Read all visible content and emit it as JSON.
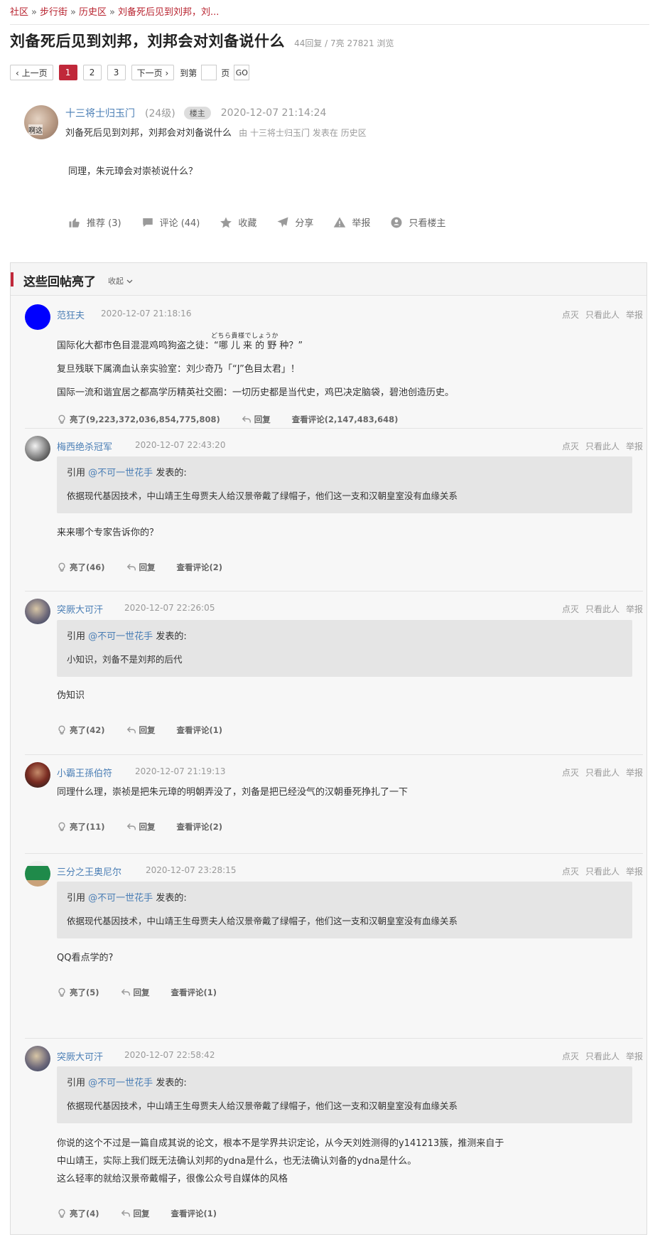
{
  "breadcrumb": [
    "社区",
    "步行街",
    "历史区",
    "刘备死后见到刘邦，刘..."
  ],
  "breadcrumb_sep": "»",
  "title": "刘备死后见到刘邦，刘邦会对刘备说什么",
  "stats": "44回复 / 7亮 27821 浏览",
  "pager": {
    "prev": "‹ 上一页",
    "pages": [
      "1",
      "2",
      "3"
    ],
    "next": "下一页 ›",
    "goto_before": "到第",
    "goto_after": "页",
    "go": "GO"
  },
  "op": {
    "avatar_text": "啊这",
    "author": "十三将士归玉门",
    "level": "(24级)",
    "badge": "楼主",
    "time": "2020-12-07 21:14:24",
    "subtitle": "刘备死后见到刘邦，刘邦会对刘备说什么",
    "by_prefix": "由",
    "by_author": "十三将士归玉门",
    "by_mid": "发表在",
    "by_section": "历史区",
    "body": "同理，朱元璋会对崇祯说什么？",
    "actions": {
      "recommend": "推荐 (3)",
      "comment": "评论 (44)",
      "favorite": "收藏",
      "share": "分享",
      "report": "举报",
      "only_op": "只看楼主"
    }
  },
  "hot": {
    "title": "这些回帖亮了",
    "collapse": "收起"
  },
  "reply_opts": {
    "dislike": "点灭",
    "only_this": "只看此人",
    "report": "举报"
  },
  "reply_actions": {
    "reply": "回复"
  },
  "quote_prefix": "引用",
  "quote_suffix": "发表的:",
  "replies": [
    {
      "author": "范狂夫",
      "time": "2020-12-07 21:18:16",
      "avatar_color": "#0000ff",
      "ruby": "どちら貴様でしょうか",
      "lines": [
        "国际化大都市色目混混鸡鸣狗盗之徒：“哪 儿 来 的 野 种？”",
        "复旦残联下属滴血认亲实验室：刘少奇乃「“J”色目太君」！",
        "国际一流和谐宜居之都高学历精英社交圈：一切历史都是当代史，鸡巴决定脑袋，碧池创造历史。"
      ],
      "light": "亮了(9,223,372,036,854,775,808)",
      "comments": "查看评论(2,147,483,648)"
    },
    {
      "author": "梅西绝杀冠军",
      "time": "2020-12-07 22:43:20",
      "quote_user": "@不可一世花手",
      "quote_text": "依据现代基因技术，中山靖王生母贾夫人给汉景帝戴了绿帽子，他们这一支和汉朝皇室没有血缘关系",
      "lines": [
        "来来哪个专家告诉你的？"
      ],
      "light": "亮了(46)",
      "comments": "查看评论(2)"
    },
    {
      "author": "突厥大可汗",
      "time": "2020-12-07 22:26:05",
      "quote_user": "@不可一世花手",
      "quote_text": "小知识，刘备不是刘邦的后代",
      "lines": [
        "伪知识"
      ],
      "light": "亮了(42)",
      "comments": "查看评论(1)"
    },
    {
      "author": "小霸王孫伯符",
      "time": "2020-12-07 21:19:13",
      "lines": [
        "同理什么理，崇祯是把朱元璋的明朝弄没了，刘备是把已经没气的汉朝垂死挣扎了一下"
      ],
      "light": "亮了(11)",
      "comments": "查看评论(2)"
    },
    {
      "author": "三分之王奥尼尔",
      "time": "2020-12-07 23:28:15",
      "quote_user": "@不可一世花手",
      "quote_text": "依据现代基因技术，中山靖王生母贾夫人给汉景帝戴了绿帽子，他们这一支和汉朝皇室没有血缘关系",
      "lines": [
        "QQ看点学的?"
      ],
      "light": "亮了(5)",
      "comments": "查看评论(1)"
    },
    {
      "author": "突厥大可汗",
      "time": "2020-12-07 22:58:42",
      "quote_user": "@不可一世花手",
      "quote_text": "依据现代基因技术，中山靖王生母贾夫人给汉景帝戴了绿帽子，他们这一支和汉朝皇室没有血缘关系",
      "lines": [
        "你说的这个不过是一篇自成其说的论文，根本不是学界共识定论，从今天刘姓测得的y141213簇，推测来自于",
        "中山靖王，实际上我们既无法确认刘邦的ydna是什么，也无法确认刘备的ydna是什么。",
        "这么轻率的就给汉景帝戴帽子，很像公众号自媒体的风格"
      ],
      "light": "亮了(4)",
      "comments": "查看评论(1)"
    }
  ]
}
